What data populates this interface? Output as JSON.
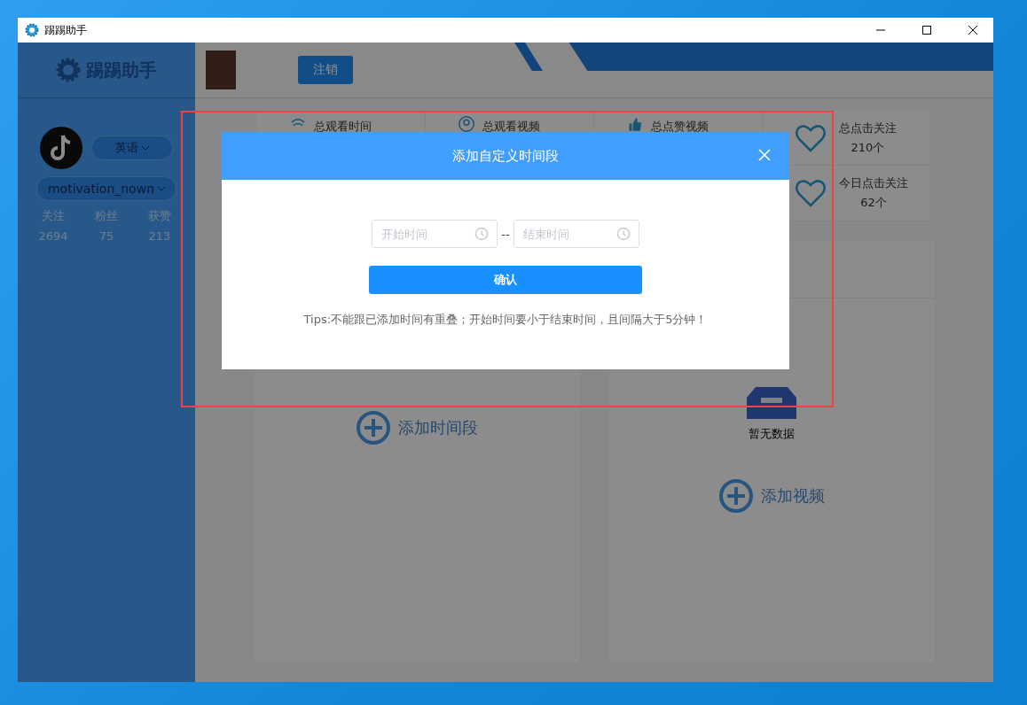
{
  "window": {
    "title": "踢踢助手"
  },
  "sidebar": {
    "logo_text": "踢踢助手",
    "language": "英语",
    "account": "motivation_nown",
    "stats": [
      {
        "label": "关注",
        "value": "2694"
      },
      {
        "label": "粉丝",
        "value": "75"
      },
      {
        "label": "获赞",
        "value": "213"
      }
    ]
  },
  "header": {
    "logout_button": "注销"
  },
  "stats_row_1": [
    {
      "kind": "time",
      "label": "总观看时间"
    },
    {
      "kind": "video",
      "label": "总观看视频"
    },
    {
      "kind": "like",
      "label": "总点赞视频"
    },
    {
      "kind": "heart",
      "label": "总点击关注",
      "value": "210个"
    }
  ],
  "stats_row_2": [
    {
      "kind": "heart",
      "label": "今日点击关注",
      "value": "62个"
    }
  ],
  "left_panel": {
    "add_button": "添加时间段"
  },
  "right_panel": {
    "empty_text": "暂无数据",
    "add_button": "添加视频"
  },
  "dialog": {
    "title": "添加自定义时间段",
    "start_placeholder": "开始时间",
    "separator": "--",
    "end_placeholder": "结束时间",
    "confirm_button": "确认",
    "tips": "Tips:不能跟已添加时间有重叠；开始时间要小于结束时间，且间隔大于5分钟！"
  }
}
